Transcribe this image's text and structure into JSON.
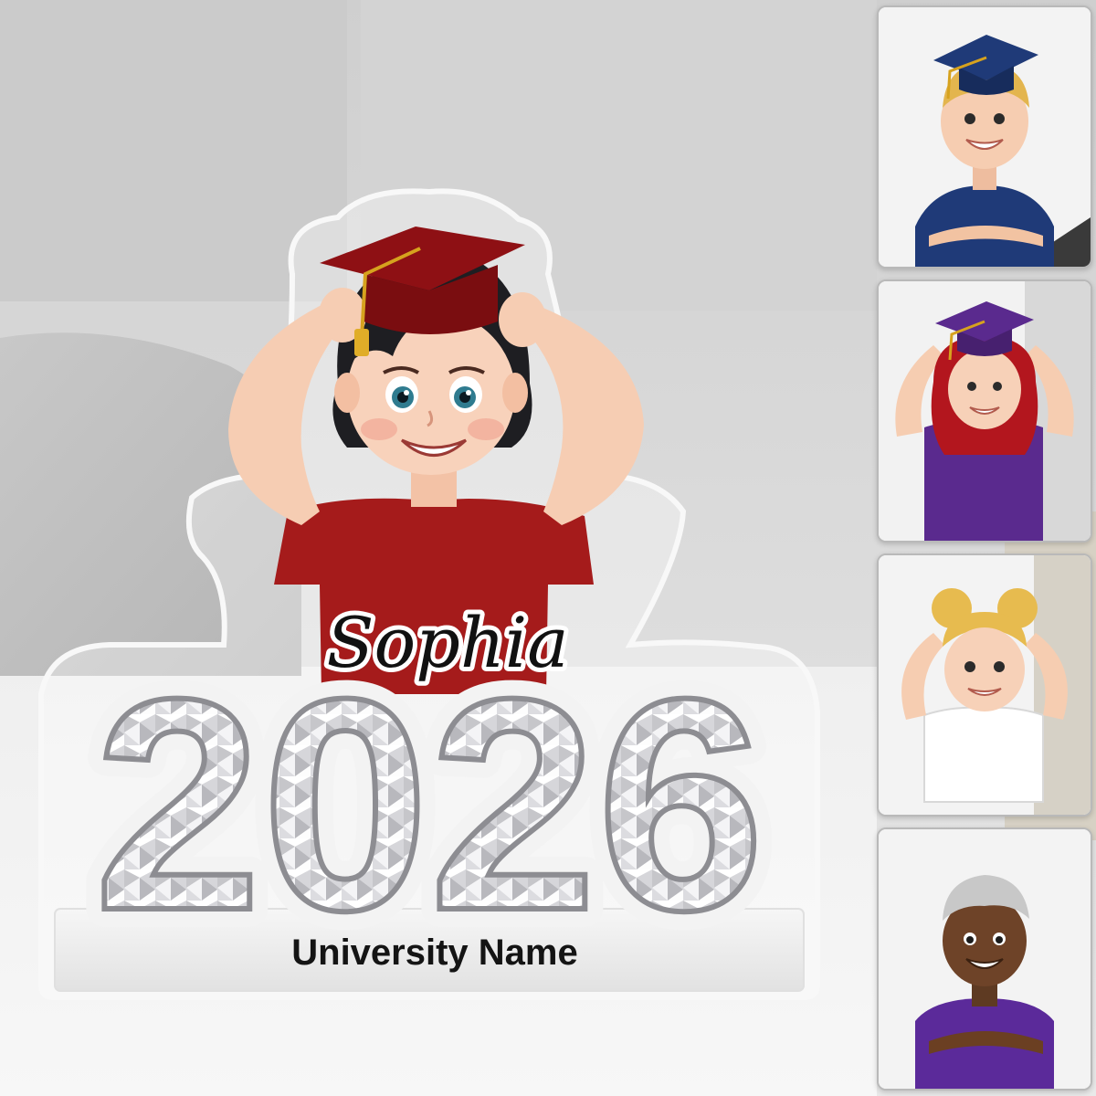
{
  "product": {
    "name_text": "Sophia",
    "year_text": "2026",
    "university_text": "University Name"
  },
  "colors": {
    "cap_main": "#8e1014",
    "shirt_main": "#a51b1b",
    "thumb_colors": [
      "#1f3a78",
      "#5a2a8e",
      "#ffffff",
      "#5b2a9a"
    ]
  },
  "thumbnails": [
    {
      "id": "boy-blond-blue-cap"
    },
    {
      "id": "girl-red-hair-purple-cap"
    },
    {
      "id": "girl-blonde-buns-white-shirt"
    },
    {
      "id": "boy-gray-hair-purple-shirt"
    }
  ]
}
